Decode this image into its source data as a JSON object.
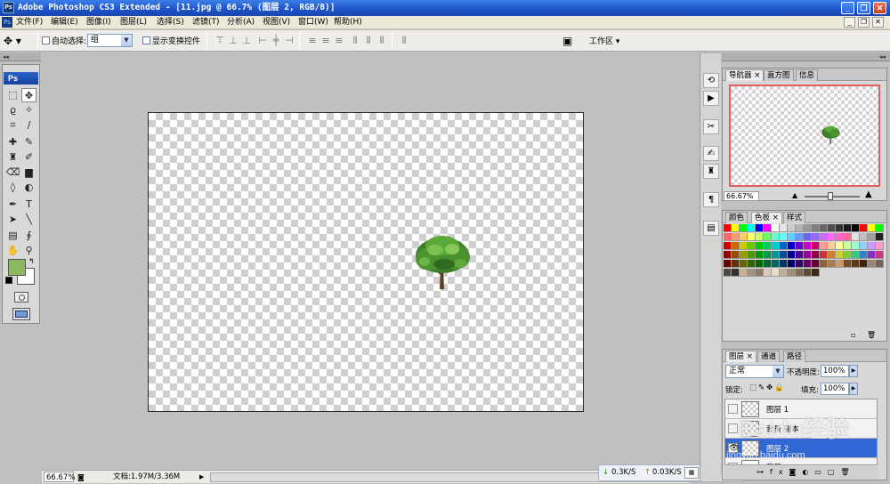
{
  "window": {
    "app_icon": "Ps",
    "title": "Adobe Photoshop CS3 Extended - [11.jpg @ 66.7% (图层 2, RGB/8)]",
    "btn_minimize": "_",
    "btn_restore": "❐",
    "btn_close": "✕"
  },
  "menubar": {
    "items": [
      {
        "label": "文件(F)"
      },
      {
        "label": "编辑(E)"
      },
      {
        "label": "图像(I)"
      },
      {
        "label": "图层(L)"
      },
      {
        "label": "选择(S)"
      },
      {
        "label": "滤镜(T)"
      },
      {
        "label": "分析(A)"
      },
      {
        "label": "视图(V)"
      },
      {
        "label": "窗口(W)"
      },
      {
        "label": "帮助(H)"
      }
    ]
  },
  "options": {
    "auto_select_label": "自动选择:",
    "auto_select_value": "组",
    "show_transform_label": "显示变换控件",
    "workspace_label": "工作区 ▾"
  },
  "toolbox": {
    "header": "Ps",
    "foreground_color": "#8cb860",
    "background_color": "#ffffff"
  },
  "status": {
    "zoom": "66.67%",
    "doc_info": "文档:1.97M/3.36M",
    "net_down": "0.3K/S",
    "net_up": "0.03K/S"
  },
  "navigator": {
    "tabs": [
      "导航器",
      "直方图",
      "信息"
    ],
    "zoom": "66.67%"
  },
  "color_panel": {
    "tabs": [
      "颜色",
      "色板",
      "样式"
    ]
  },
  "layers_panel": {
    "tabs": [
      "图层",
      "通道",
      "路径"
    ],
    "blend_mode": "正常",
    "opacity_label": "不透明度:",
    "opacity_value": "100%",
    "lock_label": "锁定:",
    "fill_label": "填充:",
    "fill_value": "100%",
    "layers": [
      {
        "name": "图层 1",
        "visible": false,
        "selected": false
      },
      {
        "name": "背景 副本",
        "visible": false,
        "selected": false
      },
      {
        "name": "图层 2",
        "visible": true,
        "selected": true
      },
      {
        "name": "背景",
        "visible": false,
        "selected": false
      }
    ]
  },
  "watermark": {
    "text": "Baidu经验",
    "url": "jingyan.baidu.com"
  },
  "colors": {
    "titlebar": "#1d52c8",
    "selected_layer": "#3168d5",
    "navigator_frame": "#e06060"
  }
}
